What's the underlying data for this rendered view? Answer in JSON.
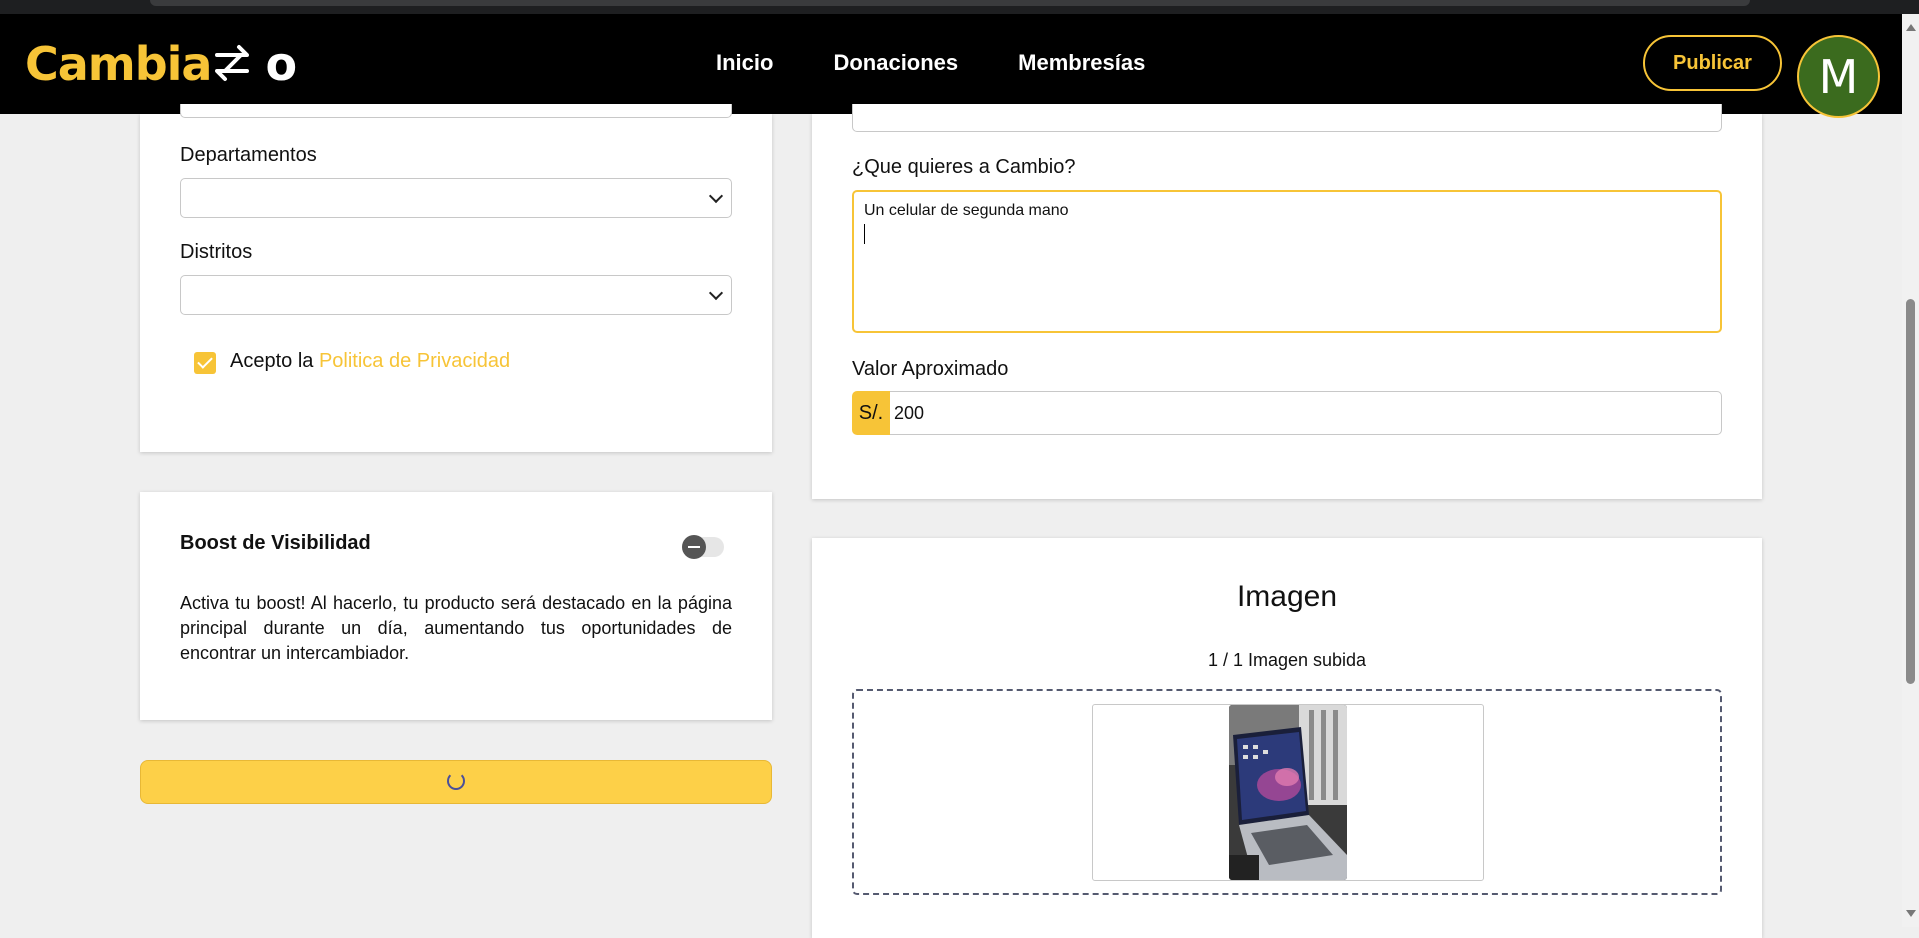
{
  "navbar": {
    "logo_text": "Cambia",
    "logo_suffix": "o",
    "links": [
      "Inicio",
      "Donaciones",
      "Membresías"
    ],
    "publish_label": "Publicar",
    "avatar_initial": "M"
  },
  "location": {
    "departments_label": "Departamentos",
    "departments_value": "",
    "districts_label": "Distritos",
    "districts_value": "",
    "privacy_checked": true,
    "privacy_prefix": "Acepto la",
    "privacy_link": "Politica de Privacidad"
  },
  "boost": {
    "title": "Boost de Visibilidad",
    "enabled": false,
    "description": "Activa tu boost! Al hacerlo, tu producto será destacado en la página principal durante un día, aumentando tus oportunidades de encontrar un intercambiador."
  },
  "exchange": {
    "want_label": "¿Que quieres a Cambio?",
    "want_value": "Un celular de segunda mano",
    "value_label": "Valor Aproximado",
    "currency": "S/.",
    "value": "200"
  },
  "image": {
    "title": "Imagen",
    "count_text": "1 / 1 Imagen subida"
  },
  "colors": {
    "accent": "#f7c437",
    "navbar": "#000000",
    "avatar": "#3b6b1e",
    "page_bg": "#efefef"
  },
  "submit": {
    "state": "loading"
  }
}
